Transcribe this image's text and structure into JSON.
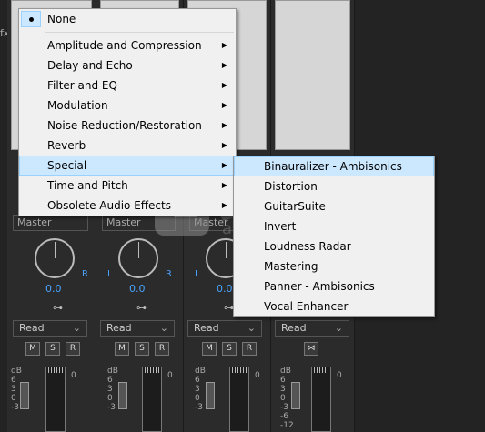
{
  "main_menu": {
    "none": "None",
    "items": [
      {
        "label": "Amplitude and Compression"
      },
      {
        "label": "Delay and Echo"
      },
      {
        "label": "Filter and EQ"
      },
      {
        "label": "Modulation"
      },
      {
        "label": "Noise Reduction/Restoration"
      },
      {
        "label": "Reverb"
      },
      {
        "label": "Special"
      },
      {
        "label": "Time and Pitch"
      },
      {
        "label": "Obsolete Audio Effects"
      }
    ],
    "highlighted": "Special",
    "submenu_arrow": "▶"
  },
  "sub_menu": {
    "items": [
      {
        "label": "Binauralizer - Ambisonics"
      },
      {
        "label": "Distortion"
      },
      {
        "label": "GuitarSuite"
      },
      {
        "label": "Invert"
      },
      {
        "label": "Loudness Radar"
      },
      {
        "label": "Mastering"
      },
      {
        "label": "Panner - Ambisonics"
      },
      {
        "label": "Vocal Enhancer"
      }
    ],
    "highlighted": "Binauralizer - Ambisonics"
  },
  "mixer": {
    "strips": [
      {
        "prefader": "Master",
        "pan_left": "L",
        "pan_right": "R",
        "pan_value": "0.0",
        "automation": "Read",
        "mute": "M",
        "solo": "S",
        "record": "R"
      },
      {
        "prefader": "Master",
        "pan_left": "L",
        "pan_right": "R",
        "pan_value": "0.0",
        "automation": "Read",
        "mute": "M",
        "solo": "S",
        "record": "R"
      },
      {
        "prefader": "Master",
        "pan_left": "L",
        "pan_right": "R",
        "pan_value": "0.0",
        "automation": "Read",
        "mute": "M",
        "solo": "S",
        "record": "R"
      },
      {
        "prefader": "",
        "pan_left": "",
        "pan_right": "",
        "pan_value": "",
        "automation": "Read",
        "mute": "",
        "solo": "",
        "record": ""
      }
    ],
    "db_label": "dB",
    "db_scale": [
      "6",
      "3",
      "0",
      "-3"
    ],
    "master_db_scale": [
      "6",
      "3",
      "0",
      "-3",
      "-6",
      "-12"
    ],
    "meter_zero": "0",
    "chevron": "⌄"
  },
  "watermark": {
    "cn": "安下载",
    "url": "anxz.com"
  },
  "icons": {
    "submenu_arrow": "chevron-right-icon",
    "radio": "radio-bullet-icon",
    "route": "route-icon",
    "master_route": "bowtie-icon"
  },
  "colors": {
    "menu_bg": "#f0f0f0",
    "highlight": "#cce8ff",
    "highlight_border": "#99d1ff",
    "mixer_bg": "#232323",
    "pan_accent": "#4aa3ff"
  }
}
